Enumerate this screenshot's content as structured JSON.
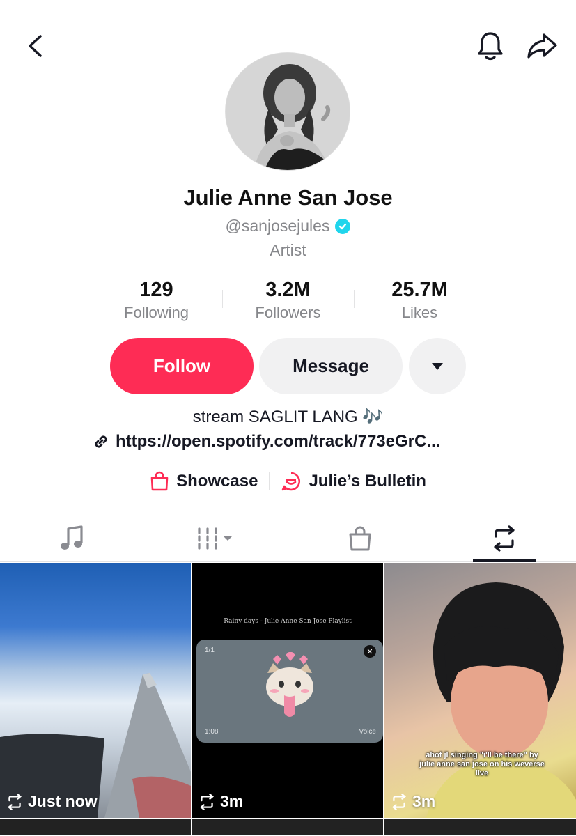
{
  "profile": {
    "name": "Julie Anne San Jose",
    "handle": "@sanjosejules",
    "category": "Artist",
    "bio": "stream SAGLIT LANG 🎶",
    "link": "https://open.spotify.com/track/773eGrC..."
  },
  "stats": [
    {
      "value": "129",
      "label": "Following"
    },
    {
      "value": "3.2M",
      "label": "Followers"
    },
    {
      "value": "25.7M",
      "label": "Likes"
    }
  ],
  "actions": {
    "follow_label": "Follow",
    "message_label": "Message"
  },
  "extras": [
    {
      "label": "Showcase",
      "icon": "shopping-bag-icon"
    },
    {
      "label": "Julie’s Bulletin",
      "icon": "bulletin-icon"
    }
  ],
  "tabs": [
    {
      "icon": "music-note-icon",
      "active": false
    },
    {
      "icon": "playlist-grid-icon",
      "active": false
    },
    {
      "icon": "shopping-bag-icon",
      "active": false
    },
    {
      "icon": "repost-icon",
      "active": true
    }
  ],
  "videos": [
    {
      "label": "Just now"
    },
    {
      "label": "3m",
      "overlay_title": "Rainy days - Julie Anne San Jose Playlist",
      "popup_count": "1/1",
      "popup_time": "1:08",
      "popup_voice": "Voice"
    },
    {
      "label": "3m",
      "caption": "ahof jl singing \"i'll be there\" by julie anne san jose on his weverse live"
    }
  ],
  "colors": {
    "accent": "#fe2c55",
    "verified": "#20d5ec",
    "secondary_text": "#86878b",
    "button_bg": "#f1f1f2"
  }
}
